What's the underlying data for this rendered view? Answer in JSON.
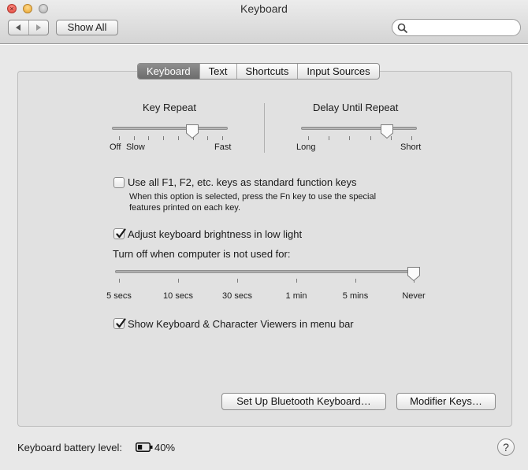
{
  "window": {
    "title": "Keyboard"
  },
  "toolbar": {
    "back_glyph": "◀",
    "forward_glyph": "▶",
    "show_all_label": "Show All",
    "search_placeholder": "",
    "search_icon": "magnifying-glass-icon"
  },
  "tabs": [
    {
      "label": "Keyboard",
      "active": true
    },
    {
      "label": "Text",
      "active": false
    },
    {
      "label": "Shortcuts",
      "active": false
    },
    {
      "label": "Input Sources",
      "active": false
    }
  ],
  "key_repeat": {
    "title": "Key Repeat",
    "labels": [
      "Off",
      "Slow",
      "Fast"
    ],
    "ticks": 8,
    "value": 0.71
  },
  "delay_until_repeat": {
    "title": "Delay Until Repeat",
    "labels": [
      "Long",
      "Short"
    ],
    "ticks": 6,
    "value": 0.76
  },
  "function_keys": {
    "checked": false,
    "label": "Use all F1, F2, etc. keys as standard function keys",
    "description_line1": "When this option is selected, press the Fn key to use the special",
    "description_line2": "features printed on each key."
  },
  "brightness": {
    "checked": true,
    "label": "Adjust keyboard brightness in low light",
    "turn_off_label": "Turn off when computer is not used for:",
    "stops": [
      "5 secs",
      "10 secs",
      "30 secs",
      "1 min",
      "5 mins",
      "Never"
    ],
    "selected_index": 5
  },
  "viewers": {
    "checked": true,
    "label": "Show Keyboard & Character Viewers in menu bar"
  },
  "buttons": {
    "bluetooth": "Set Up Bluetooth Keyboard…",
    "modifier": "Modifier Keys…"
  },
  "battery": {
    "label": "Keyboard battery level:",
    "percent": "40%",
    "level": 0.4
  },
  "help_glyph": "?",
  "colors": {
    "active_tab": "#7a7a7a",
    "check": "#1a1a1a"
  }
}
